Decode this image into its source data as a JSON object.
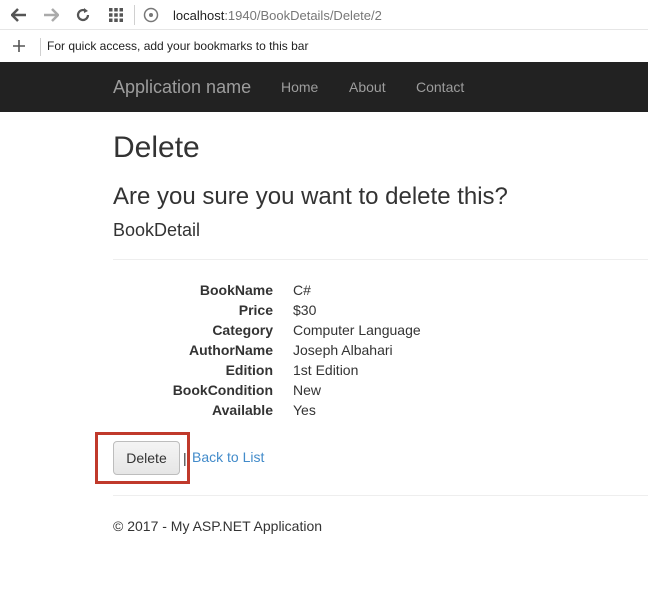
{
  "browser": {
    "url_host": "localhost",
    "url_path": ":1940/BookDetails/Delete/2",
    "bookmarks_message": "For quick access, add your bookmarks to this bar"
  },
  "navbar": {
    "brand": "Application name",
    "links": [
      "Home",
      "About",
      "Contact"
    ]
  },
  "page": {
    "title": "Delete",
    "confirm_question": "Are you sure you want to delete this?",
    "entity_name": "BookDetail",
    "fields": [
      {
        "label": "BookName",
        "value": "C#"
      },
      {
        "label": "Price",
        "value": "$30"
      },
      {
        "label": "Category",
        "value": "Computer Language"
      },
      {
        "label": "AuthorName",
        "value": "Joseph Albahari"
      },
      {
        "label": "Edition",
        "value": "1st Edition"
      },
      {
        "label": "BookCondition",
        "value": "New"
      },
      {
        "label": "Available",
        "value": "Yes"
      }
    ],
    "delete_button": "Delete",
    "separator": "|",
    "back_link": "Back to List",
    "footer": "© 2017 - My ASP.NET Application"
  },
  "colors": {
    "navbar_bg": "#222222",
    "link": "#428bca",
    "highlight_box": "#c0392b"
  }
}
